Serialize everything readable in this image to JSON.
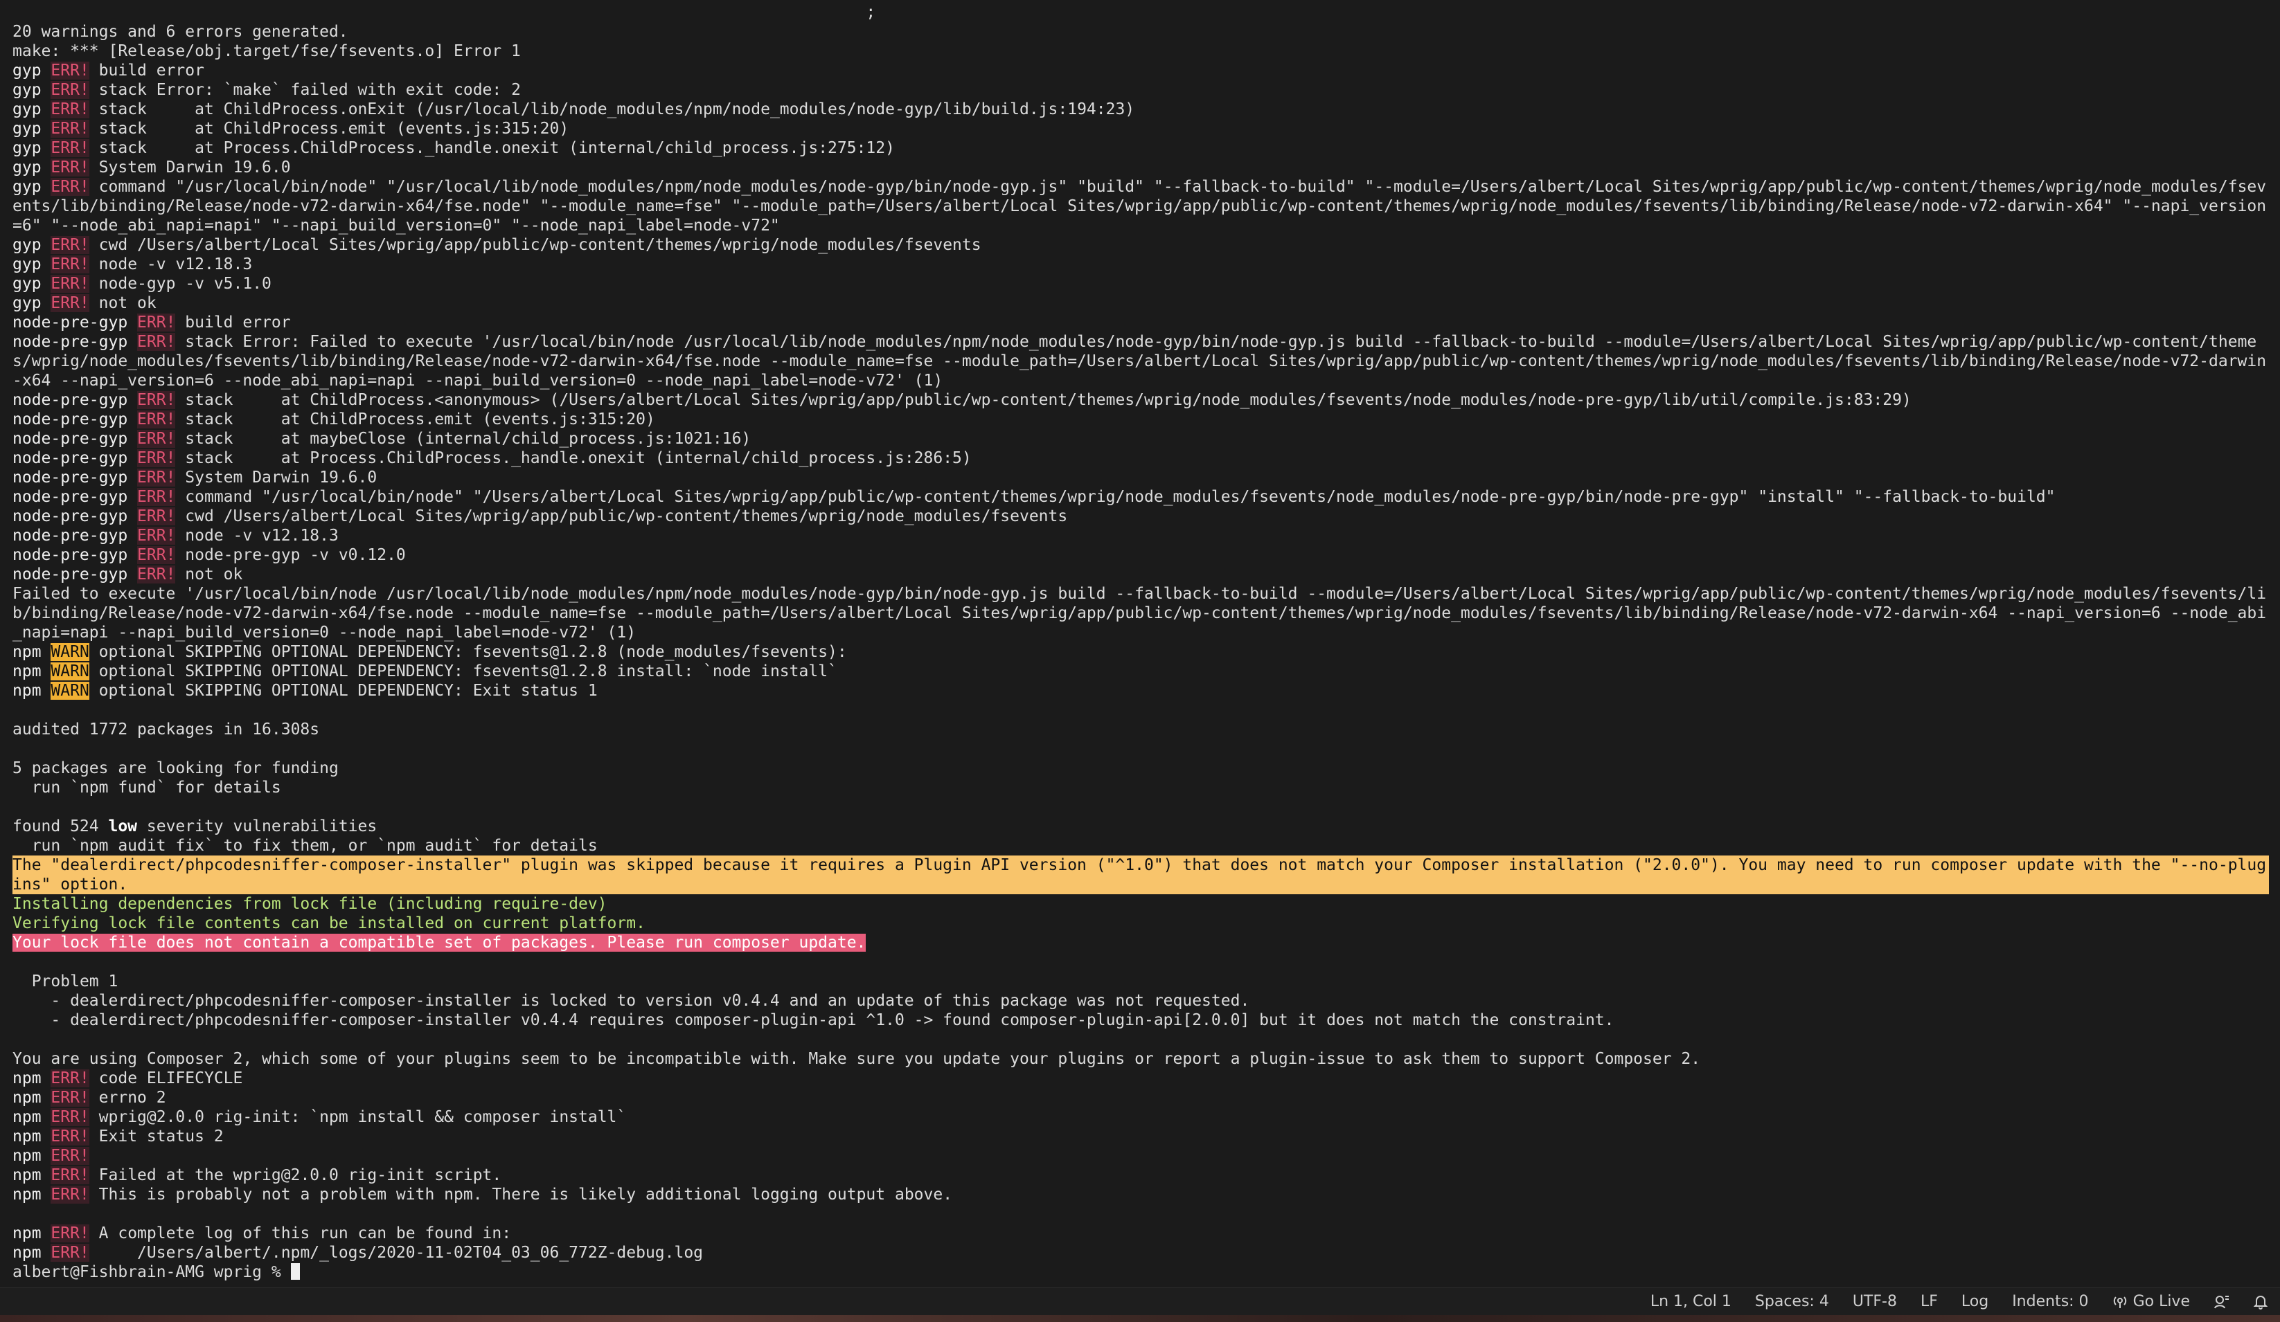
{
  "terminal": {
    "lines": [
      {
        "text": "                                                                                         ;"
      },
      {
        "text": "20 warnings and 6 errors generated."
      },
      {
        "text": "make: *** [Release/obj.target/fse/fsevents.o] Error 1"
      },
      {
        "prefix": "gyp",
        "tag": "ERR!",
        "tagType": "err",
        "text": "build error"
      },
      {
        "prefix": "gyp",
        "tag": "ERR!",
        "tagType": "err",
        "text": "stack Error: `make` failed with exit code: 2"
      },
      {
        "prefix": "gyp",
        "tag": "ERR!",
        "tagType": "err",
        "text": "stack     at ChildProcess.onExit (/usr/local/lib/node_modules/npm/node_modules/node-gyp/lib/build.js:194:23)"
      },
      {
        "prefix": "gyp",
        "tag": "ERR!",
        "tagType": "err",
        "text": "stack     at ChildProcess.emit (events.js:315:20)"
      },
      {
        "prefix": "gyp",
        "tag": "ERR!",
        "tagType": "err",
        "text": "stack     at Process.ChildProcess._handle.onexit (internal/child_process.js:275:12)"
      },
      {
        "prefix": "gyp",
        "tag": "ERR!",
        "tagType": "err",
        "text": "System Darwin 19.6.0"
      },
      {
        "prefix": "gyp",
        "tag": "ERR!",
        "tagType": "err",
        "text": "command \"/usr/local/bin/node\" \"/usr/local/lib/node_modules/npm/node_modules/node-gyp/bin/node-gyp.js\" \"build\" \"--fallback-to-build\" \"--module=/Users/albert/Local Sites/wprig/app/public/wp-content/themes/wprig/node_modules/fsevents/lib/binding/Release/node-v72-darwin-x64/fse.node\" \"--module_name=fse\" \"--module_path=/Users/albert/Local Sites/wprig/app/public/wp-content/themes/wprig/node_modules/fsevents/lib/binding/Release/node-v72-darwin-x64\" \"--napi_version=6\" \"--node_abi_napi=napi\" \"--napi_build_version=0\" \"--node_napi_label=node-v72\""
      },
      {
        "prefix": "gyp",
        "tag": "ERR!",
        "tagType": "err",
        "text": "cwd /Users/albert/Local Sites/wprig/app/public/wp-content/themes/wprig/node_modules/fsevents"
      },
      {
        "prefix": "gyp",
        "tag": "ERR!",
        "tagType": "err",
        "text": "node -v v12.18.3"
      },
      {
        "prefix": "gyp",
        "tag": "ERR!",
        "tagType": "err",
        "text": "node-gyp -v v5.1.0"
      },
      {
        "prefix": "gyp",
        "tag": "ERR!",
        "tagType": "err",
        "text": "not ok"
      },
      {
        "prefix": "node-pre-gyp",
        "tag": "ERR!",
        "tagType": "err",
        "text": "build error"
      },
      {
        "prefix": "node-pre-gyp",
        "tag": "ERR!",
        "tagType": "err",
        "text": "stack Error: Failed to execute '/usr/local/bin/node /usr/local/lib/node_modules/npm/node_modules/node-gyp/bin/node-gyp.js build --fallback-to-build --module=/Users/albert/Local Sites/wprig/app/public/wp-content/themes/wprig/node_modules/fsevents/lib/binding/Release/node-v72-darwin-x64/fse.node --module_name=fse --module_path=/Users/albert/Local Sites/wprig/app/public/wp-content/themes/wprig/node_modules/fsevents/lib/binding/Release/node-v72-darwin-x64 --napi_version=6 --node_abi_napi=napi --napi_build_version=0 --node_napi_label=node-v72' (1)"
      },
      {
        "prefix": "node-pre-gyp",
        "tag": "ERR!",
        "tagType": "err",
        "text": "stack     at ChildProcess.<anonymous> (/Users/albert/Local Sites/wprig/app/public/wp-content/themes/wprig/node_modules/fsevents/node_modules/node-pre-gyp/lib/util/compile.js:83:29)"
      },
      {
        "prefix": "node-pre-gyp",
        "tag": "ERR!",
        "tagType": "err",
        "text": "stack     at ChildProcess.emit (events.js:315:20)"
      },
      {
        "prefix": "node-pre-gyp",
        "tag": "ERR!",
        "tagType": "err",
        "text": "stack     at maybeClose (internal/child_process.js:1021:16)"
      },
      {
        "prefix": "node-pre-gyp",
        "tag": "ERR!",
        "tagType": "err",
        "text": "stack     at Process.ChildProcess._handle.onexit (internal/child_process.js:286:5)"
      },
      {
        "prefix": "node-pre-gyp",
        "tag": "ERR!",
        "tagType": "err",
        "text": "System Darwin 19.6.0"
      },
      {
        "prefix": "node-pre-gyp",
        "tag": "ERR!",
        "tagType": "err",
        "text": "command \"/usr/local/bin/node\" \"/Users/albert/Local Sites/wprig/app/public/wp-content/themes/wprig/node_modules/fsevents/node_modules/node-pre-gyp/bin/node-pre-gyp\" \"install\" \"--fallback-to-build\""
      },
      {
        "prefix": "node-pre-gyp",
        "tag": "ERR!",
        "tagType": "err",
        "text": "cwd /Users/albert/Local Sites/wprig/app/public/wp-content/themes/wprig/node_modules/fsevents"
      },
      {
        "prefix": "node-pre-gyp",
        "tag": "ERR!",
        "tagType": "err",
        "text": "node -v v12.18.3"
      },
      {
        "prefix": "node-pre-gyp",
        "tag": "ERR!",
        "tagType": "err",
        "text": "node-pre-gyp -v v0.12.0"
      },
      {
        "prefix": "node-pre-gyp",
        "tag": "ERR!",
        "tagType": "err",
        "text": "not ok"
      },
      {
        "text": "Failed to execute '/usr/local/bin/node /usr/local/lib/node_modules/npm/node_modules/node-gyp/bin/node-gyp.js build --fallback-to-build --module=/Users/albert/Local Sites/wprig/app/public/wp-content/themes/wprig/node_modules/fsevents/lib/binding/Release/node-v72-darwin-x64/fse.node --module_name=fse --module_path=/Users/albert/Local Sites/wprig/app/public/wp-content/themes/wprig/node_modules/fsevents/lib/binding/Release/node-v72-darwin-x64 --napi_version=6 --node_abi_napi=napi --napi_build_version=0 --node_napi_label=node-v72' (1)"
      },
      {
        "prefix": "npm",
        "tag": "WARN",
        "tagType": "warn",
        "text": "optional SKIPPING OPTIONAL DEPENDENCY: fsevents@1.2.8 (node_modules/fsevents):"
      },
      {
        "prefix": "npm",
        "tag": "WARN",
        "tagType": "warn",
        "text": "optional SKIPPING OPTIONAL DEPENDENCY: fsevents@1.2.8 install: `node install`"
      },
      {
        "prefix": "npm",
        "tag": "WARN",
        "tagType": "warn",
        "text": "optional SKIPPING OPTIONAL DEPENDENCY: Exit status 1"
      },
      {
        "text": ""
      },
      {
        "text": "audited 1772 packages in 16.308s"
      },
      {
        "text": ""
      },
      {
        "text": "5 packages are looking for funding"
      },
      {
        "text": "  run `npm fund` for details"
      },
      {
        "text": ""
      },
      {
        "text": "found 524 ",
        "bold": "low",
        "after": " severity vulnerabilities"
      },
      {
        "text": "  run `npm audit fix` to fix them, or `npm audit` for details"
      },
      {
        "style": "full-yellow",
        "text": "The \"dealerdirect/phpcodesniffer-composer-installer\" plugin was skipped because it requires a Plugin API version (\"^1.0\") that does not match your Composer installation (\"2.0.0\"). You may need to run composer update with the \"--no-plugins\" option."
      },
      {
        "style": "green",
        "text": "Installing dependencies from lock file (including require-dev)"
      },
      {
        "style": "green",
        "text": "Verifying lock file contents can be installed on current platform."
      },
      {
        "style": "full-red",
        "text": "Your lock file does not contain a compatible set of packages. Please run composer update."
      },
      {
        "text": ""
      },
      {
        "text": "  Problem 1"
      },
      {
        "text": "    - dealerdirect/phpcodesniffer-composer-installer is locked to version v0.4.4 and an update of this package was not requested."
      },
      {
        "text": "    - dealerdirect/phpcodesniffer-composer-installer v0.4.4 requires composer-plugin-api ^1.0 -> found composer-plugin-api[2.0.0] but it does not match the constraint."
      },
      {
        "text": ""
      },
      {
        "text": "You are using Composer 2, which some of your plugins seem to be incompatible with. Make sure you update your plugins or report a plugin-issue to ask them to support Composer 2."
      },
      {
        "prefix": "npm",
        "tag": "ERR!",
        "tagType": "err",
        "text": "code ELIFECYCLE"
      },
      {
        "prefix": "npm",
        "tag": "ERR!",
        "tagType": "err",
        "text": "errno 2"
      },
      {
        "prefix": "npm",
        "tag": "ERR!",
        "tagType": "err",
        "text": "wprig@2.0.0 rig-init: `npm install && composer install`"
      },
      {
        "prefix": "npm",
        "tag": "ERR!",
        "tagType": "err",
        "text": "Exit status 2"
      },
      {
        "prefix": "npm",
        "tag": "ERR!",
        "tagType": "err",
        "text": ""
      },
      {
        "prefix": "npm",
        "tag": "ERR!",
        "tagType": "err",
        "text": "Failed at the wprig@2.0.0 rig-init script."
      },
      {
        "prefix": "npm",
        "tag": "ERR!",
        "tagType": "err",
        "text": "This is probably not a problem with npm. There is likely additional logging output above."
      },
      {
        "text": ""
      },
      {
        "prefix": "npm",
        "tag": "ERR!",
        "tagType": "err",
        "text": "A complete log of this run can be found in:"
      },
      {
        "prefix": "npm",
        "tag": "ERR!",
        "tagType": "err",
        "text": "    /Users/albert/.npm/_logs/2020-11-02T04_03_06_772Z-debug.log"
      }
    ],
    "prompt": "albert@Fishbrain-AMG wprig % "
  },
  "statusbar": {
    "position": "Ln 1, Col 1",
    "spaces": "Spaces: 4",
    "encoding": "UTF-8",
    "eol": "LF",
    "language": "Log",
    "indents": "Indents: 0",
    "golive": "Go Live",
    "icons": [
      "broadcast-icon",
      "feedback-icon",
      "bell-icon"
    ]
  },
  "colors": {
    "err_tag": "#e05272",
    "warn_tag": "#f2b133",
    "warning_line": "#f8c46b",
    "error_line": "#e85c7b",
    "green_text": "#b9e27a"
  }
}
